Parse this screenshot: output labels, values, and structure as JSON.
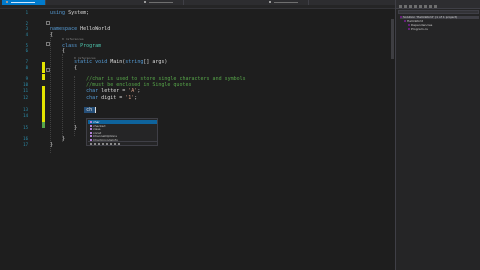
{
  "editor": {
    "lines": [
      {
        "num": "1",
        "html": "<span class=\"kw\">using</span> System;"
      },
      {
        "num": "2",
        "html": ""
      },
      {
        "num": "3",
        "html": "<span class=\"kw\">namespace</span> HelloWorld"
      },
      {
        "num": "4",
        "html": "{"
      },
      {
        "num": "5",
        "html": "    <span class=\"kw\">class</span> <span class=\"ty\">Program</span>"
      },
      {
        "num": "6",
        "html": "    {"
      },
      {
        "num": "7",
        "html": "        <span class=\"kw\">static</span> <span class=\"kw\">void</span> Main(<span class=\"kw\">string</span>[] args)"
      },
      {
        "num": "8",
        "html": "        {"
      },
      {
        "num": "9",
        "html": "            <span class=\"cm\">//char is used to store single characters and symbols</span>"
      },
      {
        "num": "10",
        "html": "            <span class=\"cm\">//must be enclosed in Single quotes</span>"
      },
      {
        "num": "11",
        "html": "            <span class=\"kw\">char</span> letter = <span class=\"st\">'A'</span>;"
      },
      {
        "num": "12",
        "html": "            <span class=\"kw\">char</span> digit = <span class=\"st\">'1'</span>;"
      },
      {
        "num": "13",
        "html": "            ch"
      },
      {
        "num": "14",
        "html": ""
      },
      {
        "num": "15",
        "html": "        }"
      },
      {
        "num": "16",
        "html": "    }"
      },
      {
        "num": "17",
        "html": "}"
      }
    ]
  },
  "autocomplete": {
    "items": [
      {
        "label": "char",
        "selected": true
      },
      {
        "label": "checked",
        "selected": false
      },
      {
        "label": "class",
        "selected": false
      },
      {
        "label": "const",
        "selected": false
      },
      {
        "label": "ChannelOptions",
        "selected": false
      },
      {
        "label": "CharUnicodeInfo",
        "selected": false
      }
    ]
  },
  "solution_explorer": {
    "nodes": [
      {
        "label": "Solution 'HelloWorld' (1 of 1 project)",
        "depth": 0,
        "selected": true
      },
      {
        "label": "HelloWorld",
        "depth": 1,
        "selected": false
      },
      {
        "label": "Dependencies",
        "depth": 2,
        "selected": false
      },
      {
        "label": "Program.cs",
        "depth": 2,
        "selected": false
      }
    ]
  }
}
